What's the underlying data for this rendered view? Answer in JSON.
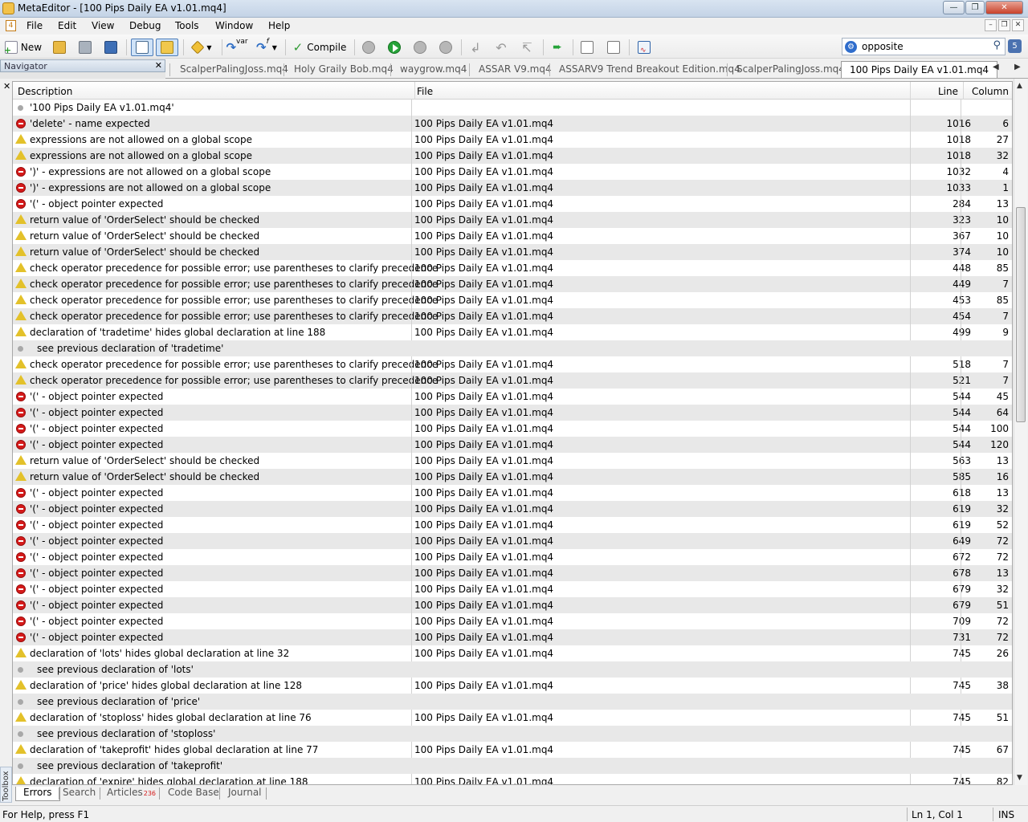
{
  "window": {
    "title": "MetaEditor - [100 Pips Daily EA v1.01.mq4]"
  },
  "menu": [
    "File",
    "Edit",
    "View",
    "Debug",
    "Tools",
    "Window",
    "Help"
  ],
  "toolbar": {
    "new_label": "New",
    "compile_label": "Compile",
    "var_label": "var",
    "f_label": "f"
  },
  "search": {
    "value": "opposite",
    "notification_count": "5"
  },
  "navigator": {
    "title": "Navigator"
  },
  "tabs": [
    "ScalperPalingJoss.mq4",
    "Holy Graily Bob.mq4",
    "waygrow.mq4",
    "ASSAR V9.mq4",
    "ASSARV9 Trend Breakout Edition.mq4",
    "ScalperPalingJoss.mq4",
    "100 Pips Daily EA v1.01.mq4"
  ],
  "active_tab": 6,
  "columns": {
    "description": "Description",
    "file": "File",
    "line": "Line",
    "column": "Column"
  },
  "rows": [
    {
      "type": "info",
      "desc": "'100 Pips Daily EA v1.01.mq4'",
      "file": "",
      "line": "",
      "col": ""
    },
    {
      "type": "error",
      "desc": "'delete' - name expected",
      "file": "100 Pips Daily EA v1.01.mq4",
      "line": "1016",
      "col": "6"
    },
    {
      "type": "warning",
      "desc": "expressions are not allowed on a global scope",
      "file": "100 Pips Daily EA v1.01.mq4",
      "line": "1018",
      "col": "27"
    },
    {
      "type": "warning",
      "desc": "expressions are not allowed on a global scope",
      "file": "100 Pips Daily EA v1.01.mq4",
      "line": "1018",
      "col": "32"
    },
    {
      "type": "error",
      "desc": "')' - expressions are not allowed on a global scope",
      "file": "100 Pips Daily EA v1.01.mq4",
      "line": "1032",
      "col": "4"
    },
    {
      "type": "error",
      "desc": "')' - expressions are not allowed on a global scope",
      "file": "100 Pips Daily EA v1.01.mq4",
      "line": "1033",
      "col": "1"
    },
    {
      "type": "error",
      "desc": "'(' - object pointer expected",
      "file": "100 Pips Daily EA v1.01.mq4",
      "line": "284",
      "col": "13"
    },
    {
      "type": "warning",
      "desc": "return value of 'OrderSelect' should be checked",
      "file": "100 Pips Daily EA v1.01.mq4",
      "line": "323",
      "col": "10"
    },
    {
      "type": "warning",
      "desc": "return value of 'OrderSelect' should be checked",
      "file": "100 Pips Daily EA v1.01.mq4",
      "line": "367",
      "col": "10"
    },
    {
      "type": "warning",
      "desc": "return value of 'OrderSelect' should be checked",
      "file": "100 Pips Daily EA v1.01.mq4",
      "line": "374",
      "col": "10"
    },
    {
      "type": "warning",
      "desc": "check operator precedence for possible error; use parentheses to clarify precedence",
      "file": "100 Pips Daily EA v1.01.mq4",
      "line": "448",
      "col": "85"
    },
    {
      "type": "warning",
      "desc": "check operator precedence for possible error; use parentheses to clarify precedence",
      "file": "100 Pips Daily EA v1.01.mq4",
      "line": "449",
      "col": "7"
    },
    {
      "type": "warning",
      "desc": "check operator precedence for possible error; use parentheses to clarify precedence",
      "file": "100 Pips Daily EA v1.01.mq4",
      "line": "453",
      "col": "85"
    },
    {
      "type": "warning",
      "desc": "check operator precedence for possible error; use parentheses to clarify precedence",
      "file": "100 Pips Daily EA v1.01.mq4",
      "line": "454",
      "col": "7"
    },
    {
      "type": "warning",
      "desc": "declaration of 'tradetime' hides global declaration at line 188",
      "file": "100 Pips Daily EA v1.01.mq4",
      "line": "499",
      "col": "9"
    },
    {
      "type": "info",
      "sub": true,
      "desc": "see previous declaration of 'tradetime'",
      "file": "",
      "line": "",
      "col": ""
    },
    {
      "type": "warning",
      "desc": "check operator precedence for possible error; use parentheses to clarify precedence",
      "file": "100 Pips Daily EA v1.01.mq4",
      "line": "518",
      "col": "7"
    },
    {
      "type": "warning",
      "desc": "check operator precedence for possible error; use parentheses to clarify precedence",
      "file": "100 Pips Daily EA v1.01.mq4",
      "line": "521",
      "col": "7"
    },
    {
      "type": "error",
      "desc": "'(' - object pointer expected",
      "file": "100 Pips Daily EA v1.01.mq4",
      "line": "544",
      "col": "45"
    },
    {
      "type": "error",
      "desc": "'(' - object pointer expected",
      "file": "100 Pips Daily EA v1.01.mq4",
      "line": "544",
      "col": "64"
    },
    {
      "type": "error",
      "desc": "'(' - object pointer expected",
      "file": "100 Pips Daily EA v1.01.mq4",
      "line": "544",
      "col": "100"
    },
    {
      "type": "error",
      "desc": "'(' - object pointer expected",
      "file": "100 Pips Daily EA v1.01.mq4",
      "line": "544",
      "col": "120"
    },
    {
      "type": "warning",
      "desc": "return value of 'OrderSelect' should be checked",
      "file": "100 Pips Daily EA v1.01.mq4",
      "line": "563",
      "col": "13"
    },
    {
      "type": "warning",
      "desc": "return value of 'OrderSelect' should be checked",
      "file": "100 Pips Daily EA v1.01.mq4",
      "line": "585",
      "col": "16"
    },
    {
      "type": "error",
      "desc": "'(' - object pointer expected",
      "file": "100 Pips Daily EA v1.01.mq4",
      "line": "618",
      "col": "13"
    },
    {
      "type": "error",
      "desc": "'(' - object pointer expected",
      "file": "100 Pips Daily EA v1.01.mq4",
      "line": "619",
      "col": "32"
    },
    {
      "type": "error",
      "desc": "'(' - object pointer expected",
      "file": "100 Pips Daily EA v1.01.mq4",
      "line": "619",
      "col": "52"
    },
    {
      "type": "error",
      "desc": "'(' - object pointer expected",
      "file": "100 Pips Daily EA v1.01.mq4",
      "line": "649",
      "col": "72"
    },
    {
      "type": "error",
      "desc": "'(' - object pointer expected",
      "file": "100 Pips Daily EA v1.01.mq4",
      "line": "672",
      "col": "72"
    },
    {
      "type": "error",
      "desc": "'(' - object pointer expected",
      "file": "100 Pips Daily EA v1.01.mq4",
      "line": "678",
      "col": "13"
    },
    {
      "type": "error",
      "desc": "'(' - object pointer expected",
      "file": "100 Pips Daily EA v1.01.mq4",
      "line": "679",
      "col": "32"
    },
    {
      "type": "error",
      "desc": "'(' - object pointer expected",
      "file": "100 Pips Daily EA v1.01.mq4",
      "line": "679",
      "col": "51"
    },
    {
      "type": "error",
      "desc": "'(' - object pointer expected",
      "file": "100 Pips Daily EA v1.01.mq4",
      "line": "709",
      "col": "72"
    },
    {
      "type": "error",
      "desc": "'(' - object pointer expected",
      "file": "100 Pips Daily EA v1.01.mq4",
      "line": "731",
      "col": "72"
    },
    {
      "type": "warning",
      "desc": "declaration of 'lots' hides global declaration at line 32",
      "file": "100 Pips Daily EA v1.01.mq4",
      "line": "745",
      "col": "26"
    },
    {
      "type": "info",
      "sub": true,
      "desc": "see previous declaration of 'lots'",
      "file": "",
      "line": "",
      "col": ""
    },
    {
      "type": "warning",
      "desc": "declaration of 'price' hides global declaration at line 128",
      "file": "100 Pips Daily EA v1.01.mq4",
      "line": "745",
      "col": "38"
    },
    {
      "type": "info",
      "sub": true,
      "desc": "see previous declaration of 'price'",
      "file": "",
      "line": "",
      "col": ""
    },
    {
      "type": "warning",
      "desc": "declaration of 'stoploss' hides global declaration at line 76",
      "file": "100 Pips Daily EA v1.01.mq4",
      "line": "745",
      "col": "51"
    },
    {
      "type": "info",
      "sub": true,
      "desc": "see previous declaration of 'stoploss'",
      "file": "",
      "line": "",
      "col": ""
    },
    {
      "type": "warning",
      "desc": "declaration of 'takeprofit' hides global declaration at line 77",
      "file": "100 Pips Daily EA v1.01.mq4",
      "line": "745",
      "col": "67"
    },
    {
      "type": "info",
      "sub": true,
      "desc": "see previous declaration of 'takeprofit'",
      "file": "",
      "line": "",
      "col": ""
    },
    {
      "type": "warning",
      "desc": "declaration of 'expire' hides global declaration at line 188",
      "file": "100 Pips Daily EA v1.01.mq4",
      "line": "745",
      "col": "82"
    }
  ],
  "bottom_tabs": [
    {
      "label": "Errors"
    },
    {
      "label": "Search"
    },
    {
      "label": "Articles",
      "badge": "236"
    },
    {
      "label": "Code Base"
    },
    {
      "label": "Journal"
    }
  ],
  "toolbox": {
    "label": "Toolbox"
  },
  "status": {
    "help": "For Help, press F1",
    "position": "Ln 1, Col 1",
    "mode": "INS"
  },
  "colors": {
    "error": "#d51a1a",
    "warning": "#e3c12a",
    "info": "#a8a8a8",
    "row_alt": "#e8e8e8"
  }
}
